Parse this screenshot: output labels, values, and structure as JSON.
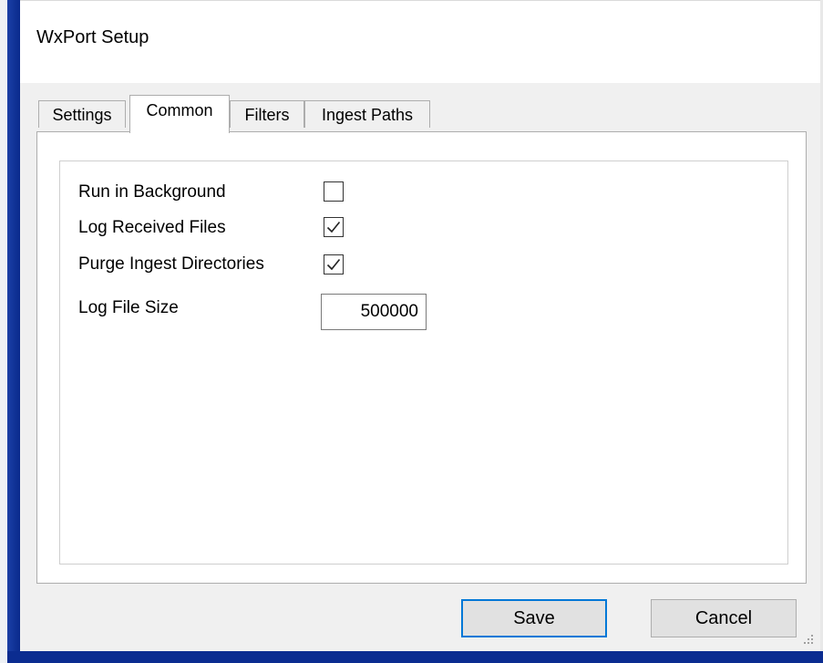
{
  "window": {
    "title": "WxPort Setup"
  },
  "tabs": [
    {
      "label": "Settings",
      "active": false
    },
    {
      "label": "Common",
      "active": true
    },
    {
      "label": "Filters",
      "active": false
    },
    {
      "label": "Ingest Paths",
      "active": false
    }
  ],
  "common": {
    "run_in_background": {
      "label": "Run in Background",
      "checked": false
    },
    "log_received_files": {
      "label": "Log Received Files",
      "checked": true
    },
    "purge_ingest_directories": {
      "label": "Purge Ingest Directories",
      "checked": true
    },
    "log_file_size": {
      "label": "Log File Size",
      "value": "500000"
    }
  },
  "buttons": {
    "save_label": "Save",
    "cancel_label": "Cancel"
  },
  "icons": {
    "checkmark": "checkmark-icon",
    "resize_grip": "resize-grip-icon"
  },
  "colors": {
    "accent": "#0078d7",
    "window_border": "#0b2c90"
  }
}
